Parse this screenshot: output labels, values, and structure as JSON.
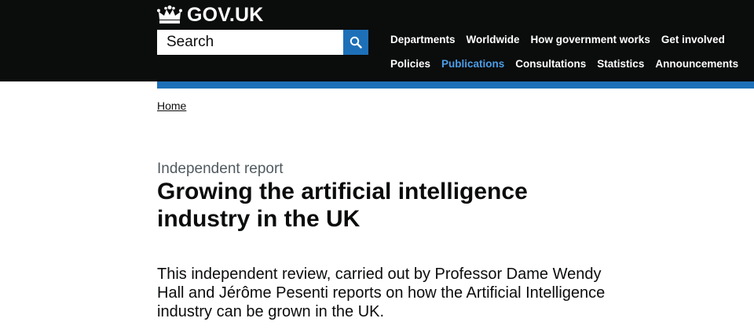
{
  "header": {
    "logo_text": "GOV.UK",
    "search": {
      "placeholder": "Search"
    },
    "nav": {
      "row1": [
        "Departments",
        "Worldwide",
        "How government works",
        "Get involved"
      ],
      "row2": [
        "Policies",
        "Publications",
        "Consultations",
        "Statistics",
        "Announcements"
      ],
      "active": "Publications"
    },
    "colors": {
      "background": "#0b0c0c",
      "accent": "#1d70b8",
      "active_link": "#4c9ee8"
    }
  },
  "breadcrumb": {
    "home": "Home"
  },
  "main": {
    "doc_type": "Independent report",
    "title": "Growing the artificial intelligence industry in the UK",
    "lede": "This independent review, carried out by Professor Dame Wendy Hall and Jérôme Pesenti reports on how the Artificial Intelligence industry can be grown in the UK."
  },
  "icons": {
    "logo": "crown-icon",
    "search": "search-icon"
  }
}
